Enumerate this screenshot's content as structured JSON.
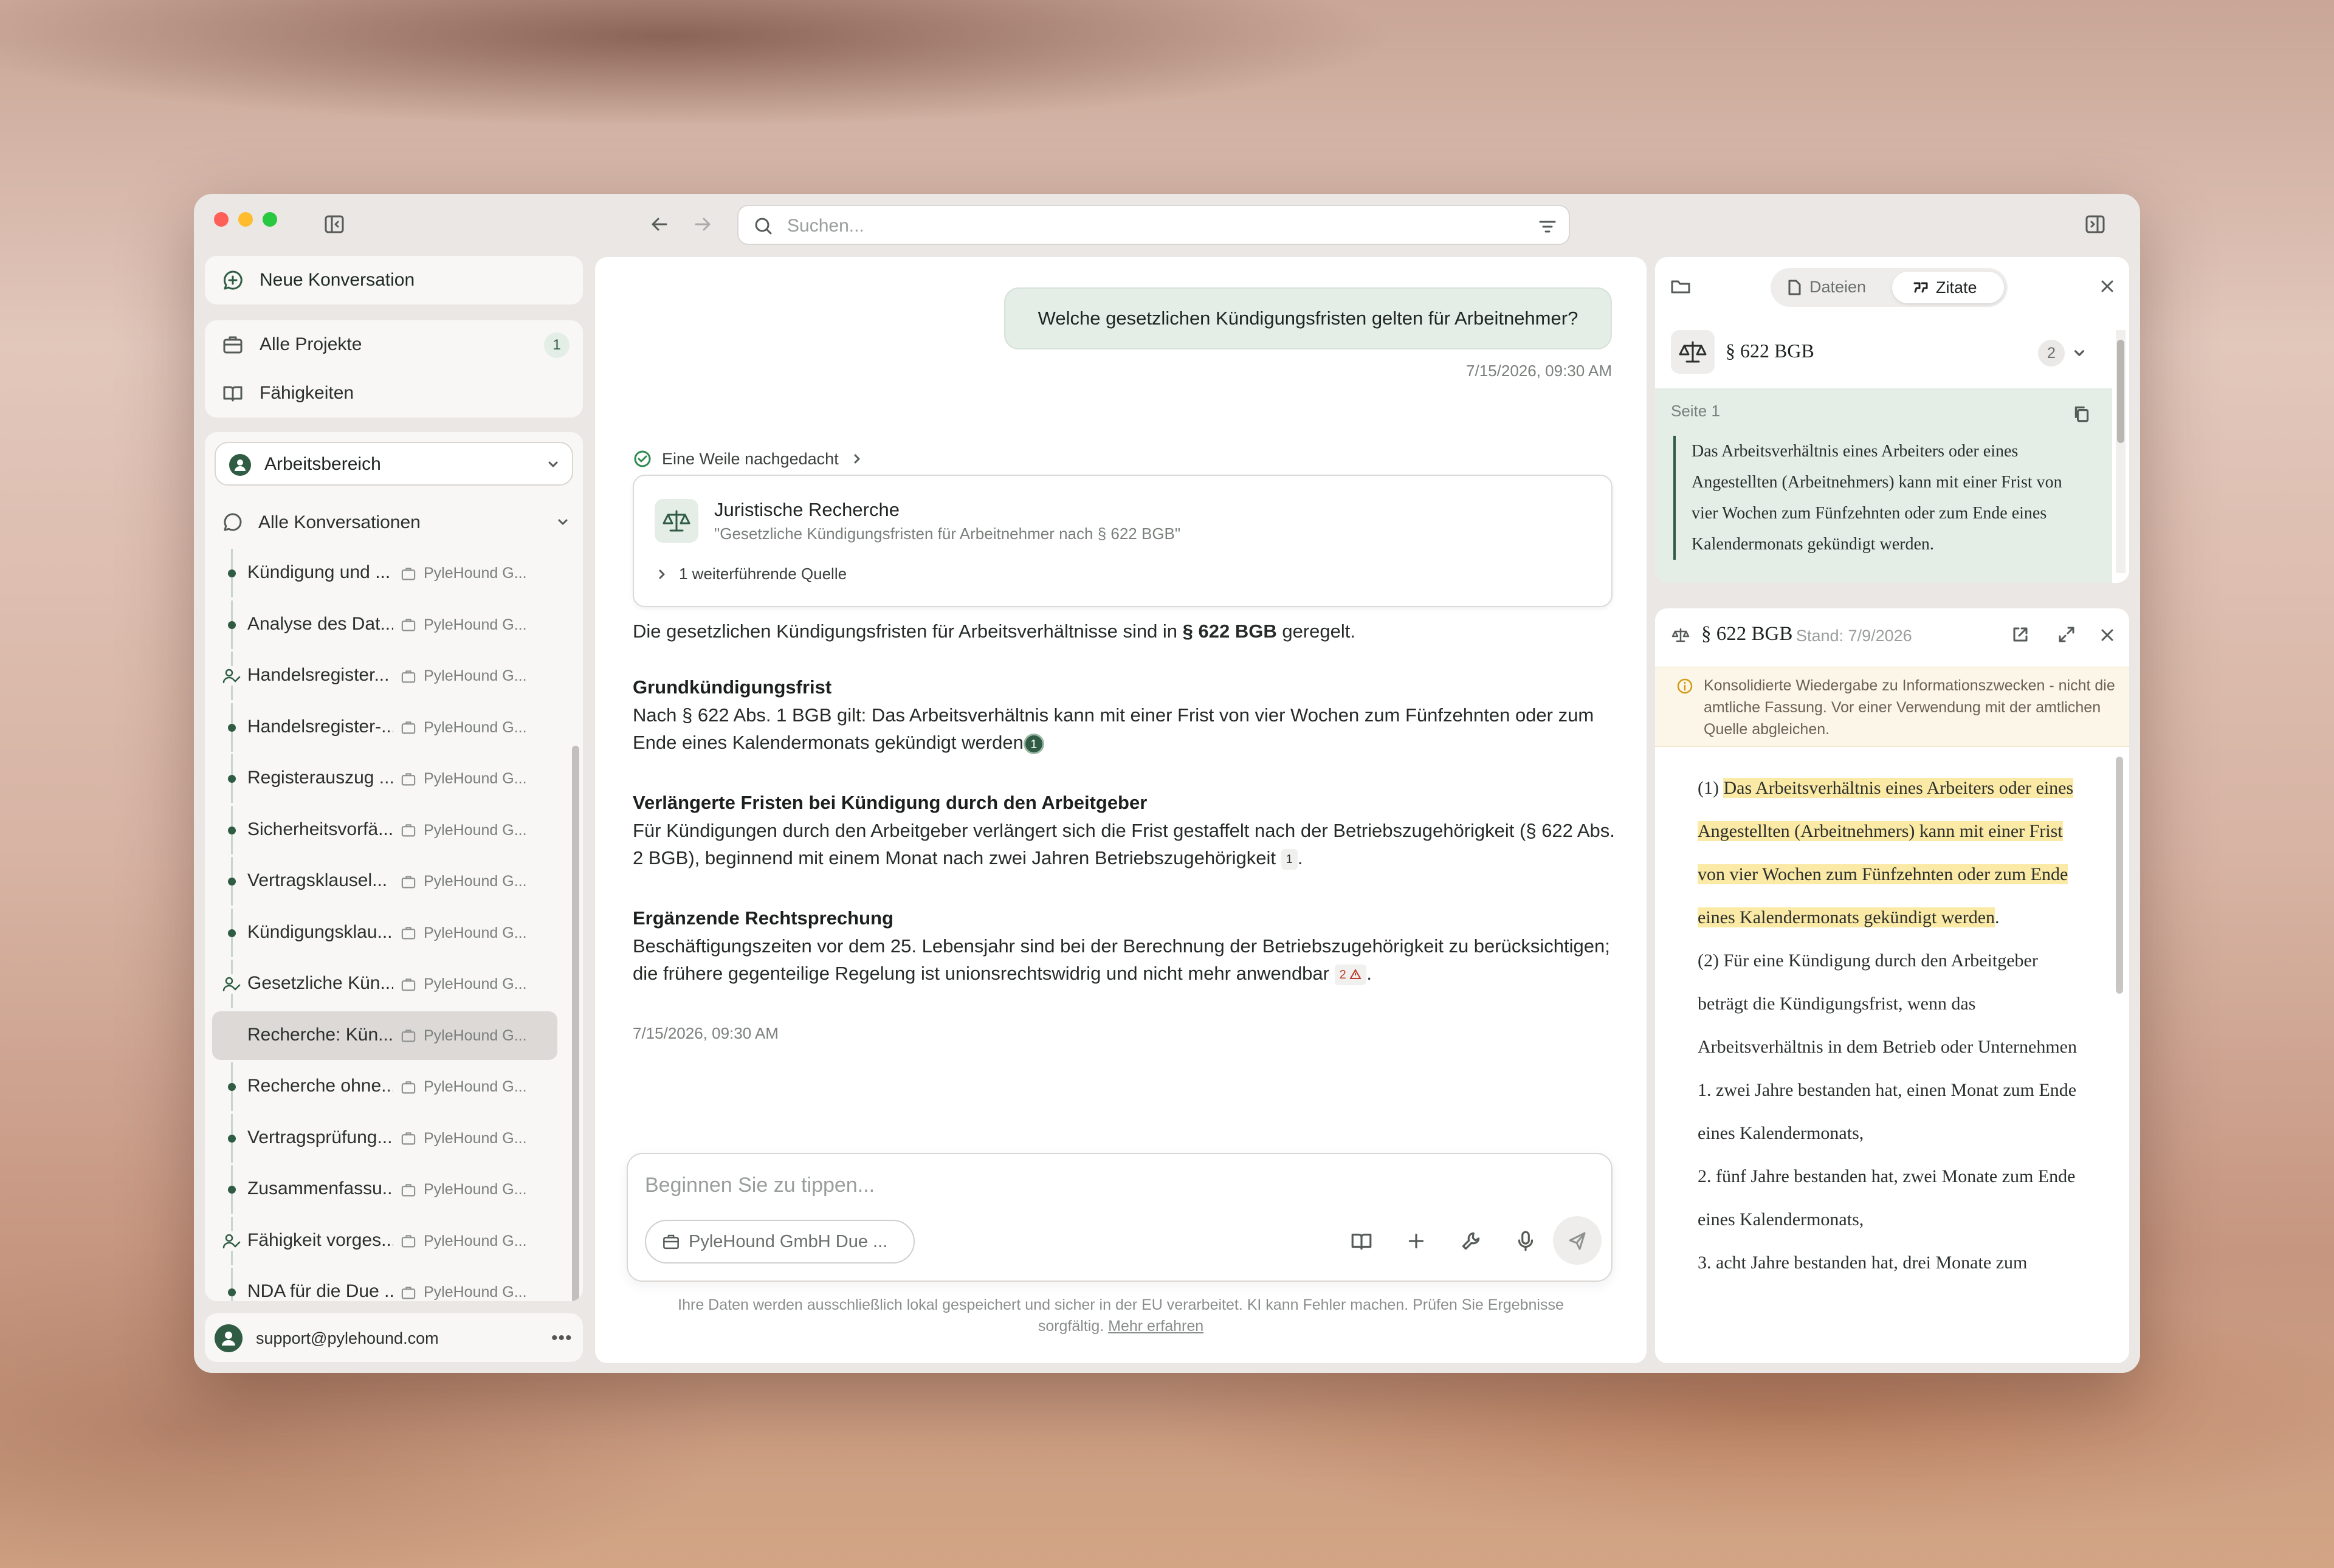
{
  "titlebar": {
    "search_placeholder": "Suchen..."
  },
  "sidebar": {
    "new_conversation": "Neue Konversation",
    "all_projects": "Alle Projekte",
    "projects_count": "1",
    "skills": "Fähigkeiten",
    "workspace": "Arbeitsbereich",
    "all_conversations": "Alle Konversationen",
    "conversations": [
      {
        "title": "Kündigung und ...",
        "project": "PyleHound G..."
      },
      {
        "title": "Analyse des Dat...",
        "project": "PyleHound G..."
      },
      {
        "title": "Handelsregister...",
        "project": "PyleHound G..."
      },
      {
        "title": "Handelsregister-...",
        "project": "PyleHound G..."
      },
      {
        "title": "Registerauszug ...",
        "project": "PyleHound G..."
      },
      {
        "title": "Sicherheitsvorfä...",
        "project": "PyleHound G..."
      },
      {
        "title": "Vertragsklausel...",
        "project": "PyleHound G..."
      },
      {
        "title": "Kündigungsklau...",
        "project": "PyleHound G..."
      },
      {
        "title": "Gesetzliche Kün...",
        "project": "PyleHound G..."
      },
      {
        "title": "Recherche: Kün...",
        "project": "PyleHound G..."
      },
      {
        "title": "Recherche ohne...",
        "project": "PyleHound G..."
      },
      {
        "title": "Vertragsprüfung...",
        "project": "PyleHound G..."
      },
      {
        "title": "Zusammenfassu...",
        "project": "PyleHound G..."
      },
      {
        "title": "Fähigkeit vorges...",
        "project": "PyleHound G..."
      },
      {
        "title": "NDA für die Due ...",
        "project": "PyleHound G..."
      }
    ],
    "user_email": "support@pylehound.com"
  },
  "chat": {
    "user_message": "Welche gesetzlichen Kündigungsfristen gelten für Arbeitnehmer?",
    "user_timestamp": "7/15/2026, 09:30 AM",
    "thinking_label": "Eine Weile nachgedacht",
    "tool_title": "Juristische Recherche",
    "tool_query": "\"Gesetzliche Kündigungsfristen für Arbeitnehmer nach § 622 BGB\"",
    "tool_sources": "1 weiterführende Quelle",
    "intro_pre": "Die gesetzlichen Kündigungsfristen für Arbeitsverhältnisse sind in ",
    "intro_bold": "§ 622 BGB",
    "intro_post": " geregelt.",
    "h1": "Grundkündigungsfrist",
    "p1": "Nach § 622 Abs. 1 BGB gilt: Das Arbeitsverhältnis kann mit einer Frist von vier Wochen zum Fünfzehnten oder zum Ende eines Kalendermonats gekündigt werden",
    "p1_cite": "1",
    "h2": "Verlängerte Fristen bei Kündigung durch den Arbeitgeber",
    "p2": "Für Kündigungen durch den Arbeitgeber verlängert sich die Frist gestaffelt nach der Betriebszugehörigkeit (§ 622 Abs. 2 BGB), beginnend mit einem Monat nach zwei Jahren Betriebszugehörigkeit",
    "p2_cite": "1",
    "h3": "Ergänzende Rechtsprechung",
    "p3": "Beschäftigungszeiten vor dem 25. Lebensjahr sind bei der Berechnung der Betriebszugehörigkeit zu berücksichtigen; die frühere gegenteilige Regelung ist unionsrechtswidrig und nicht mehr anwendbar",
    "p3_cite": "2",
    "assistant_timestamp": "7/15/2026, 09:30 AM",
    "input_placeholder": "Beginnen Sie zu tippen...",
    "project_chip": "PyleHound GmbH Due ...",
    "disclaimer": "Ihre Daten werden ausschließlich lokal gespeichert und sicher in der EU verarbeitet. KI kann Fehler machen. Prüfen Sie Ergebnisse sorgfältig.",
    "learn_more": "Mehr erfahren"
  },
  "citations_panel": {
    "tab_files": "Dateien",
    "tab_quotes": "Zitate",
    "source_title": "§ 622 BGB",
    "source_count": "2",
    "page_label": "Seite 1",
    "quote": "Das Arbeitsverhältnis eines Arbeiters oder eines Angestellten (Arbeitnehmers) kann mit einer Frist von vier Wochen zum Fünfzehnten oder zum Ende eines Kalendermonats gekündigt werden."
  },
  "document_panel": {
    "title": "§ 622 BGB",
    "status": "Stand: 7/9/2026",
    "notice": "Konsolidierte Wiedergabe zu Informationszwecken - nicht die amtliche Fassung. Vor einer Verwendung mit der amtlichen Quelle abgleichen.",
    "p1_num": "(1) ",
    "p1_highlight": "Das Arbeitsverhältnis eines Arbeiters oder eines Angestellten (Arbeitnehmers) kann mit einer Frist von vier Wochen zum Fünfzehnten oder zum Ende eines Kalendermonats gekündigt werden",
    "p1_end": ".",
    "p2": "(2) Für eine Kündigung durch den Arbeitgeber beträgt die Kündigungsfrist, wenn das Arbeitsverhältnis in dem Betrieb oder Unternehmen",
    "item1": "1. zwei Jahre bestanden hat, einen Monat zum Ende eines Kalendermonats,",
    "item2": "2. fünf Jahre bestanden hat, zwei Monate zum Ende eines Kalendermonats,",
    "item3": "3. acht Jahre bestanden hat, drei Monate zum"
  },
  "colors": {
    "accent": "#2f5c43",
    "highlight": "#fbe9a6",
    "user_bubble": "#e4ede6"
  }
}
